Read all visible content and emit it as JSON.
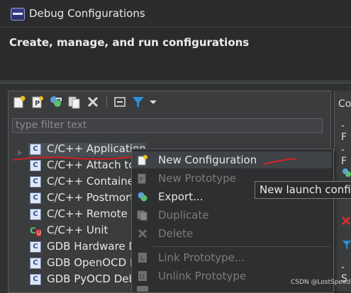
{
  "window": {
    "title": "Debug Configurations"
  },
  "header": {
    "title": "Create, manage, and run configurations"
  },
  "toolbar": {
    "buttons": [
      "new-launch-configuration-icon",
      "new-prototype-icon",
      "export-icon",
      "duplicate-icon",
      "delete-icon",
      "collapse-all-icon",
      "filter-icon",
      "view-menu-chevron-icon"
    ]
  },
  "filter": {
    "placeholder": "type filter text"
  },
  "tree": {
    "items": [
      {
        "label": "C/C++ Application",
        "icon": "c-icon"
      },
      {
        "label": "C/C++ Attach to",
        "icon": "c-icon"
      },
      {
        "label": "C/C++ Containe",
        "icon": "c-icon"
      },
      {
        "label": "C/C++ Postmort",
        "icon": "c-icon"
      },
      {
        "label": "C/C++ Remote A",
        "icon": "c-icon"
      },
      {
        "label": "C/C++ Unit",
        "icon": "c-unit-icon"
      },
      {
        "label": "GDB Hardware D",
        "icon": "c-icon"
      },
      {
        "label": "GDB OpenOCD D",
        "icon": "c-icon"
      },
      {
        "label": "GDB PyOCD Deb",
        "icon": "c-icon"
      }
    ]
  },
  "context_menu": {
    "items": [
      {
        "label": "New Configuration",
        "enabled": true
      },
      {
        "label": "New Prototype",
        "enabled": false
      },
      {
        "label": "Export...",
        "enabled": true
      },
      {
        "label": "Duplicate",
        "enabled": false
      },
      {
        "label": "Delete",
        "enabled": false
      },
      {
        "label": "Link Prototype...",
        "enabled": false
      },
      {
        "label": "Unlink Prototype",
        "enabled": false
      }
    ]
  },
  "tooltip": {
    "text": "New launch config"
  },
  "right_panel": {
    "heading": "Co",
    "bullet1": "- F",
    "bullet2": "- F",
    "bullet3": "- S"
  },
  "watermark": {
    "text": "CSDN @LostSpeed"
  },
  "colors": {
    "annotation_red": "#d32222",
    "background": "#2f3133",
    "menu_bg": "#2d2f31"
  }
}
